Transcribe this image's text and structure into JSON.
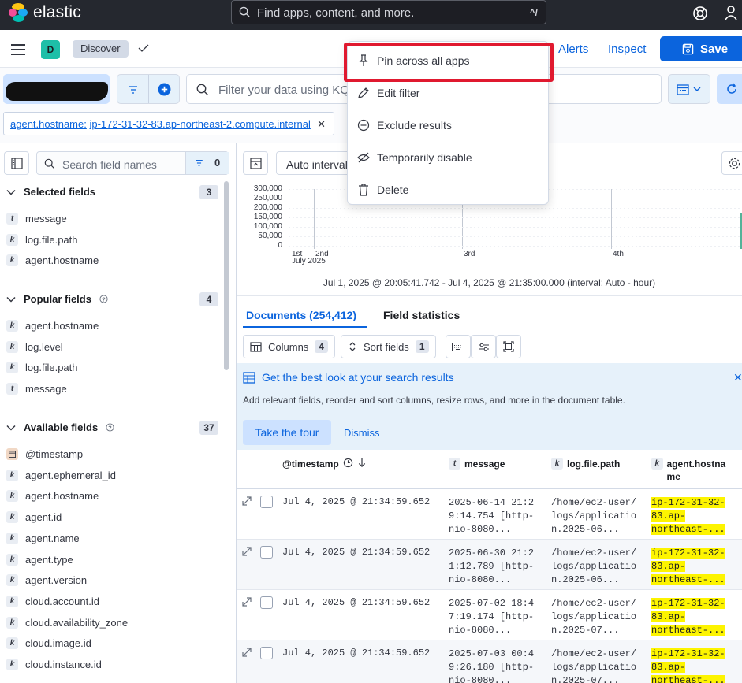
{
  "brand": {
    "name": "elastic"
  },
  "global_search": {
    "placeholder": "Find apps, content, and more.",
    "shortcut": "^/"
  },
  "appbar": {
    "space_initial": "D",
    "breadcrumb": "Discover",
    "links": {
      "alerts": "Alerts",
      "inspect": "Inspect"
    },
    "save_label": "Save"
  },
  "querybar": {
    "query_placeholder": "Filter your data using KQL syntax",
    "filter_pill": {
      "key": "agent.hostname:",
      "value": "ip-172-31-32-83.ap-northeast-2.compute.internal"
    }
  },
  "filter_menu": {
    "items": [
      {
        "label": "Pin across all apps",
        "icon": "pin-icon"
      },
      {
        "label": "Edit filter",
        "icon": "pencil-icon"
      },
      {
        "label": "Exclude results",
        "icon": "minus-circle-icon"
      },
      {
        "label": "Temporarily disable",
        "icon": "eye-closed-icon"
      },
      {
        "label": "Delete",
        "icon": "trash-icon"
      }
    ]
  },
  "sidebar": {
    "search_placeholder": "Search field names",
    "filter_count": "0",
    "selected": {
      "title": "Selected fields",
      "count": "3",
      "fields": [
        {
          "type": "t",
          "name": "message"
        },
        {
          "type": "k",
          "name": "log.file.path"
        },
        {
          "type": "k",
          "name": "agent.hostname"
        }
      ]
    },
    "popular": {
      "title": "Popular fields",
      "count": "4",
      "fields": [
        {
          "type": "k",
          "name": "agent.hostname"
        },
        {
          "type": "k",
          "name": "log.level"
        },
        {
          "type": "k",
          "name": "log.file.path"
        },
        {
          "type": "t",
          "name": "message"
        }
      ]
    },
    "available": {
      "title": "Available fields",
      "count": "37",
      "fields": [
        {
          "type": "date",
          "name": "@timestamp"
        },
        {
          "type": "k",
          "name": "agent.ephemeral_id"
        },
        {
          "type": "k",
          "name": "agent.hostname"
        },
        {
          "type": "k",
          "name": "agent.id"
        },
        {
          "type": "k",
          "name": "agent.name"
        },
        {
          "type": "k",
          "name": "agent.type"
        },
        {
          "type": "k",
          "name": "agent.version"
        },
        {
          "type": "k",
          "name": "cloud.account.id"
        },
        {
          "type": "k",
          "name": "cloud.availability_zone"
        },
        {
          "type": "k",
          "name": "cloud.image.id"
        },
        {
          "type": "k",
          "name": "cloud.instance.id"
        }
      ]
    }
  },
  "chart": {
    "interval_label": "Auto interval",
    "y_ticks": [
      "300,000",
      "250,000",
      "200,000",
      "150,000",
      "100,000",
      "50,000",
      "0"
    ],
    "x_ticks": [
      "1st",
      "2nd",
      "3rd",
      "4th"
    ],
    "x_month": "July 2025",
    "time_range": "Jul 1, 2025 @ 20:05:41.742 - Jul 4, 2025 @ 21:35:00.000 (interval: Auto - hour)"
  },
  "chart_data": {
    "type": "bar",
    "ylim": [
      0,
      300000
    ],
    "x_ticks": [
      "1st",
      "2nd",
      "3rd",
      "4th"
    ],
    "x_month": "July 2025",
    "values_note": ""
  },
  "tabs": {
    "documents": "Documents (254,412)",
    "field_statistics": "Field statistics"
  },
  "toolbar": {
    "columns": "Columns",
    "columns_count": "4",
    "sort": "Sort fields",
    "sort_count": "1"
  },
  "tour": {
    "title": "Get the best look at your search results",
    "description": "Add relevant fields, reorder and sort columns, resize rows, and more in the document table.",
    "cta": "Take the tour",
    "dismiss": "Dismiss"
  },
  "grid": {
    "columns": {
      "timestamp": "@timestamp",
      "message": "message",
      "path": "log.file.path",
      "host": "agent.hostna me"
    },
    "rows": [
      {
        "ts": "Jul 4, 2025 @ 21:34:59.652",
        "message": "2025-06-14 21:29:14.754 [http-nio-8080...",
        "path": "/home/ec2-user/logs/application.2025-06...",
        "host": "ip-172-31-32-83.ap-northeast-..."
      },
      {
        "ts": "Jul 4, 2025 @ 21:34:59.652",
        "message": "2025-06-30 21:21:12.789 [http-nio-8080...",
        "path": "/home/ec2-user/logs/application.2025-06...",
        "host": "ip-172-31-32-83.ap-northeast-..."
      },
      {
        "ts": "Jul 4, 2025 @ 21:34:59.652",
        "message": "2025-07-02 18:47:19.174 [http-nio-8080...",
        "path": "/home/ec2-user/logs/application.2025-07...",
        "host": "ip-172-31-32-83.ap-northeast-..."
      },
      {
        "ts": "Jul 4, 2025 @ 21:34:59.652",
        "message": "2025-07-03 00:49:26.180 [http-nio-8080...",
        "path": "/home/ec2-user/logs/application.2025-07...",
        "host": "ip-172-31-32-83.ap-northeast-..."
      }
    ]
  }
}
